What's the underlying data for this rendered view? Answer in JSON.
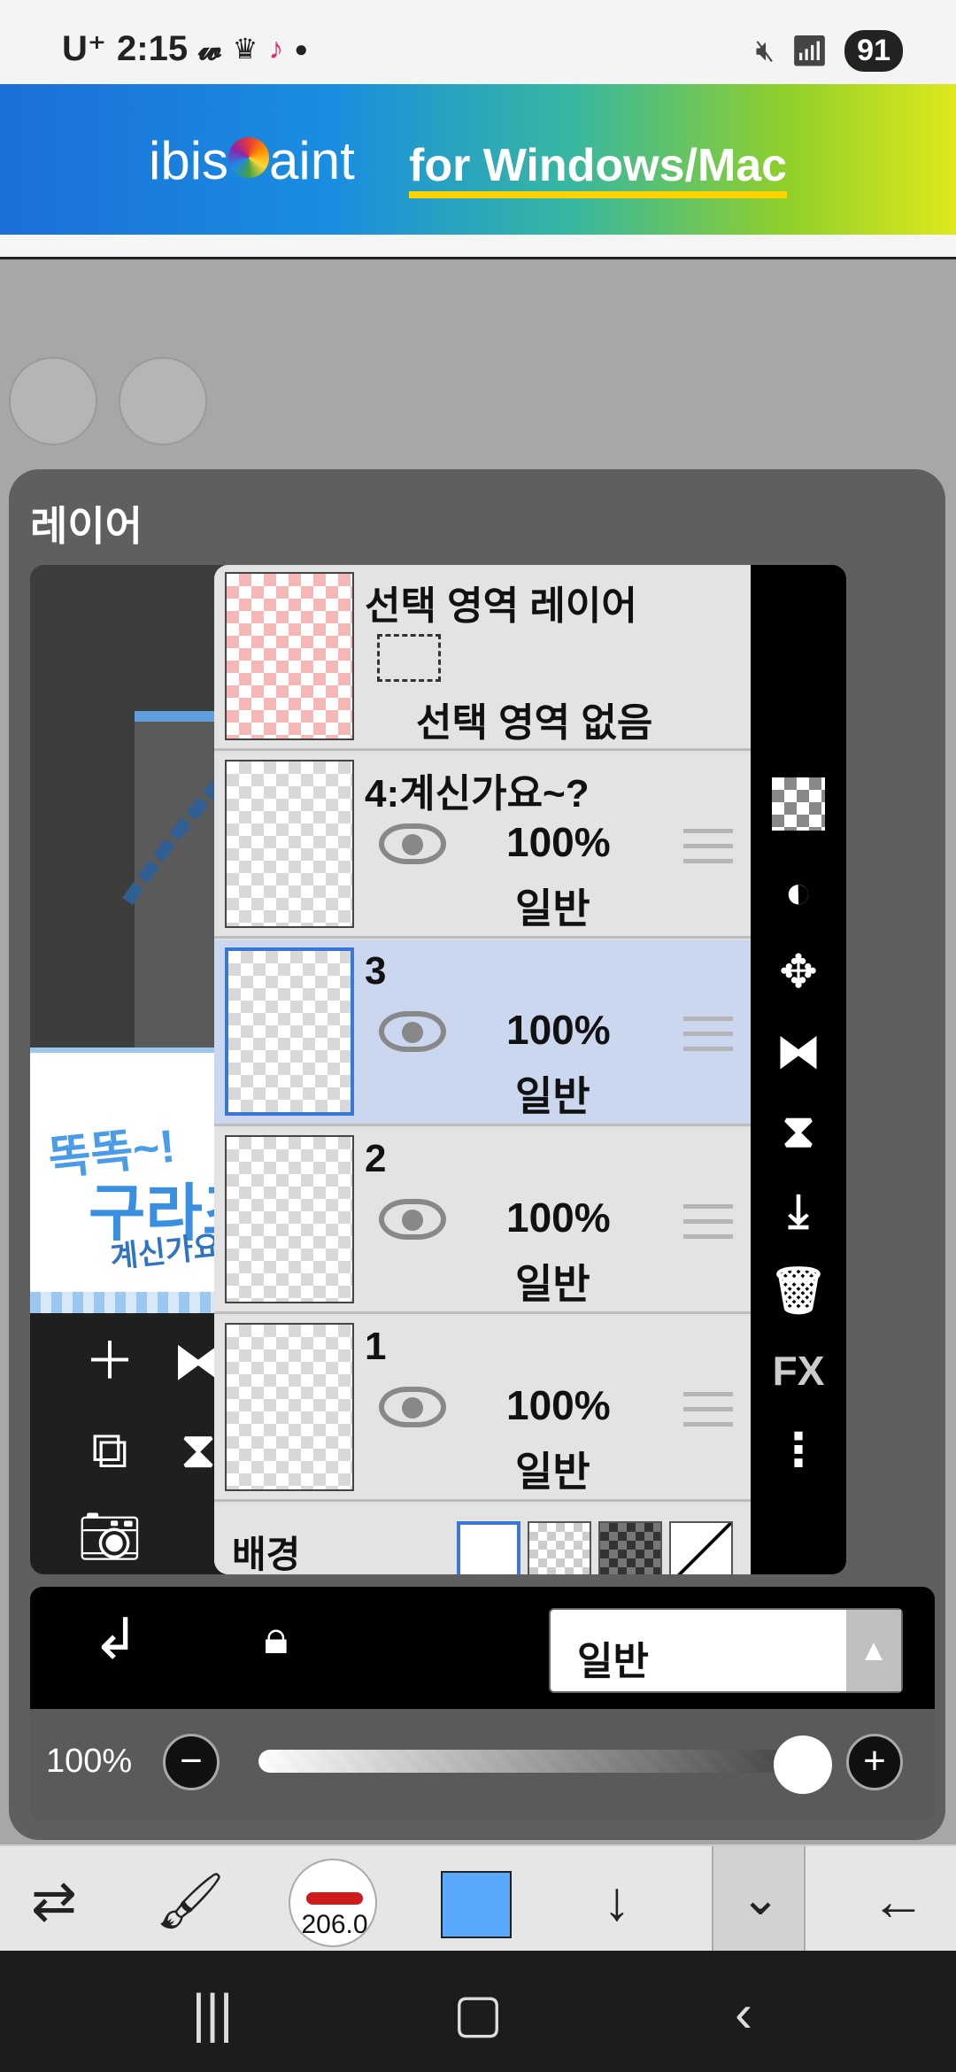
{
  "status_bar": {
    "carrier": "U⁺",
    "time": "2:15",
    "battery": "91"
  },
  "ad": {
    "logo": "ibisPaint",
    "tagline": "for Windows/Mac"
  },
  "panel": {
    "title": "레이어"
  },
  "preview": {
    "text1": "똑똑~!",
    "text2": "구라조",
    "text3": "계신가요~?"
  },
  "layers": [
    {
      "name": "선택 영역 레이어",
      "subtitle": "선택 영역 없음"
    },
    {
      "name": "4:계신가요~?",
      "opacity": "100%",
      "blend": "일반"
    },
    {
      "name": "3",
      "opacity": "100%",
      "blend": "일반"
    },
    {
      "name": "2",
      "opacity": "100%",
      "blend": "일반"
    },
    {
      "name": "1",
      "opacity": "100%",
      "blend": "일반"
    }
  ],
  "background_row": {
    "label": "배경"
  },
  "right_toolbar": {
    "fx_label": "FX"
  },
  "blend_select": {
    "value": "일반"
  },
  "opacity_bar": {
    "label": "100%",
    "value": 1.0
  },
  "app_toolbar": {
    "brush_size": "206.0",
    "color": "#5aa8fc"
  }
}
